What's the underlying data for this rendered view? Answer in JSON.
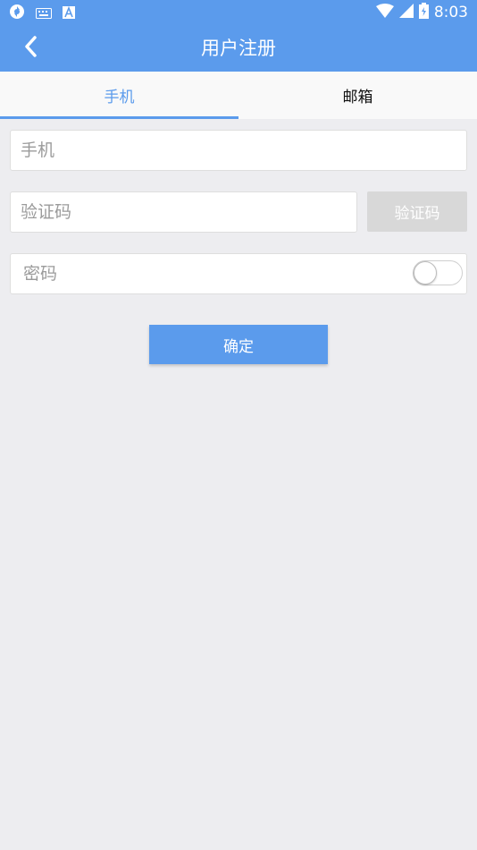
{
  "status_bar": {
    "time": "8:03",
    "left_icons": [
      "sync-icon",
      "keyboard-icon",
      "a-icon"
    ],
    "right_icons": [
      "wifi-icon",
      "signal-icon",
      "battery-icon"
    ]
  },
  "header": {
    "title": "用户注册",
    "back_icon": "chevron-left-icon"
  },
  "tabs": [
    {
      "label": "手机",
      "active": true
    },
    {
      "label": "邮箱",
      "active": false
    }
  ],
  "form": {
    "phone_placeholder": "手机",
    "phone_value": "",
    "code_placeholder": "验证码",
    "code_value": "",
    "code_button_label": "验证码",
    "password_placeholder": "密码",
    "password_value": "",
    "password_visible": false
  },
  "confirm_label": "确定",
  "colors": {
    "accent": "#5b9bec",
    "background": "#ededf0",
    "disabled_button": "#d8d8d8"
  }
}
